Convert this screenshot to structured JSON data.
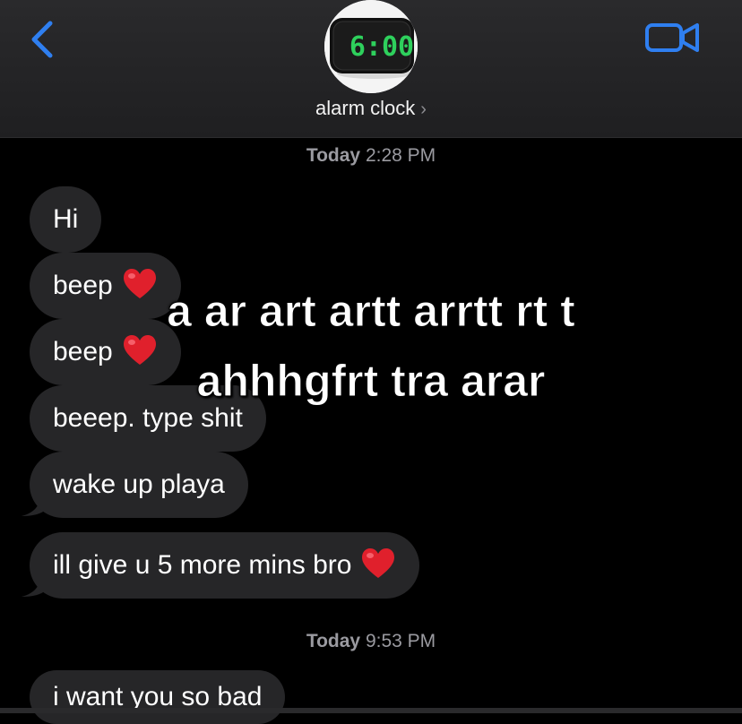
{
  "header": {
    "contact_name": "alarm clock",
    "avatar_clock_time": "6:00"
  },
  "conversation": {
    "timestamp_1": {
      "day": "Today",
      "time": "2:28 PM"
    },
    "messages_1": [
      {
        "text": "Hi",
        "emoji": ""
      },
      {
        "text": "beep",
        "emoji": "heart"
      },
      {
        "text": "beep",
        "emoji": "heart"
      },
      {
        "text": "beeep. type shit",
        "emoji": ""
      },
      {
        "text": "wake up playa",
        "emoji": ""
      },
      {
        "text": "ill give u 5 more mins bro",
        "emoji": "heart"
      }
    ],
    "timestamp_2": {
      "day": "Today",
      "time": "9:53 PM"
    },
    "messages_2": [
      {
        "text": "i want you so bad",
        "emoji": ""
      }
    ]
  },
  "overlay_caption": {
    "line_1": "a ar art artt arrtt rt t",
    "line_2": "ahhhgfrt tra arar"
  },
  "colors": {
    "accent": "#2f7ff0",
    "bubble_received": "#262628",
    "header_bg": "#2a2a2c",
    "background": "#000000",
    "timestamp_text": "#9a9aa0",
    "clock_digits": "#2ed05c",
    "heart": "#e0202c"
  },
  "icons": {
    "back": "chevron-left-icon",
    "video": "video-camera-icon",
    "contact_chevron": "chevron-right-icon",
    "heart": "red-heart-icon"
  }
}
